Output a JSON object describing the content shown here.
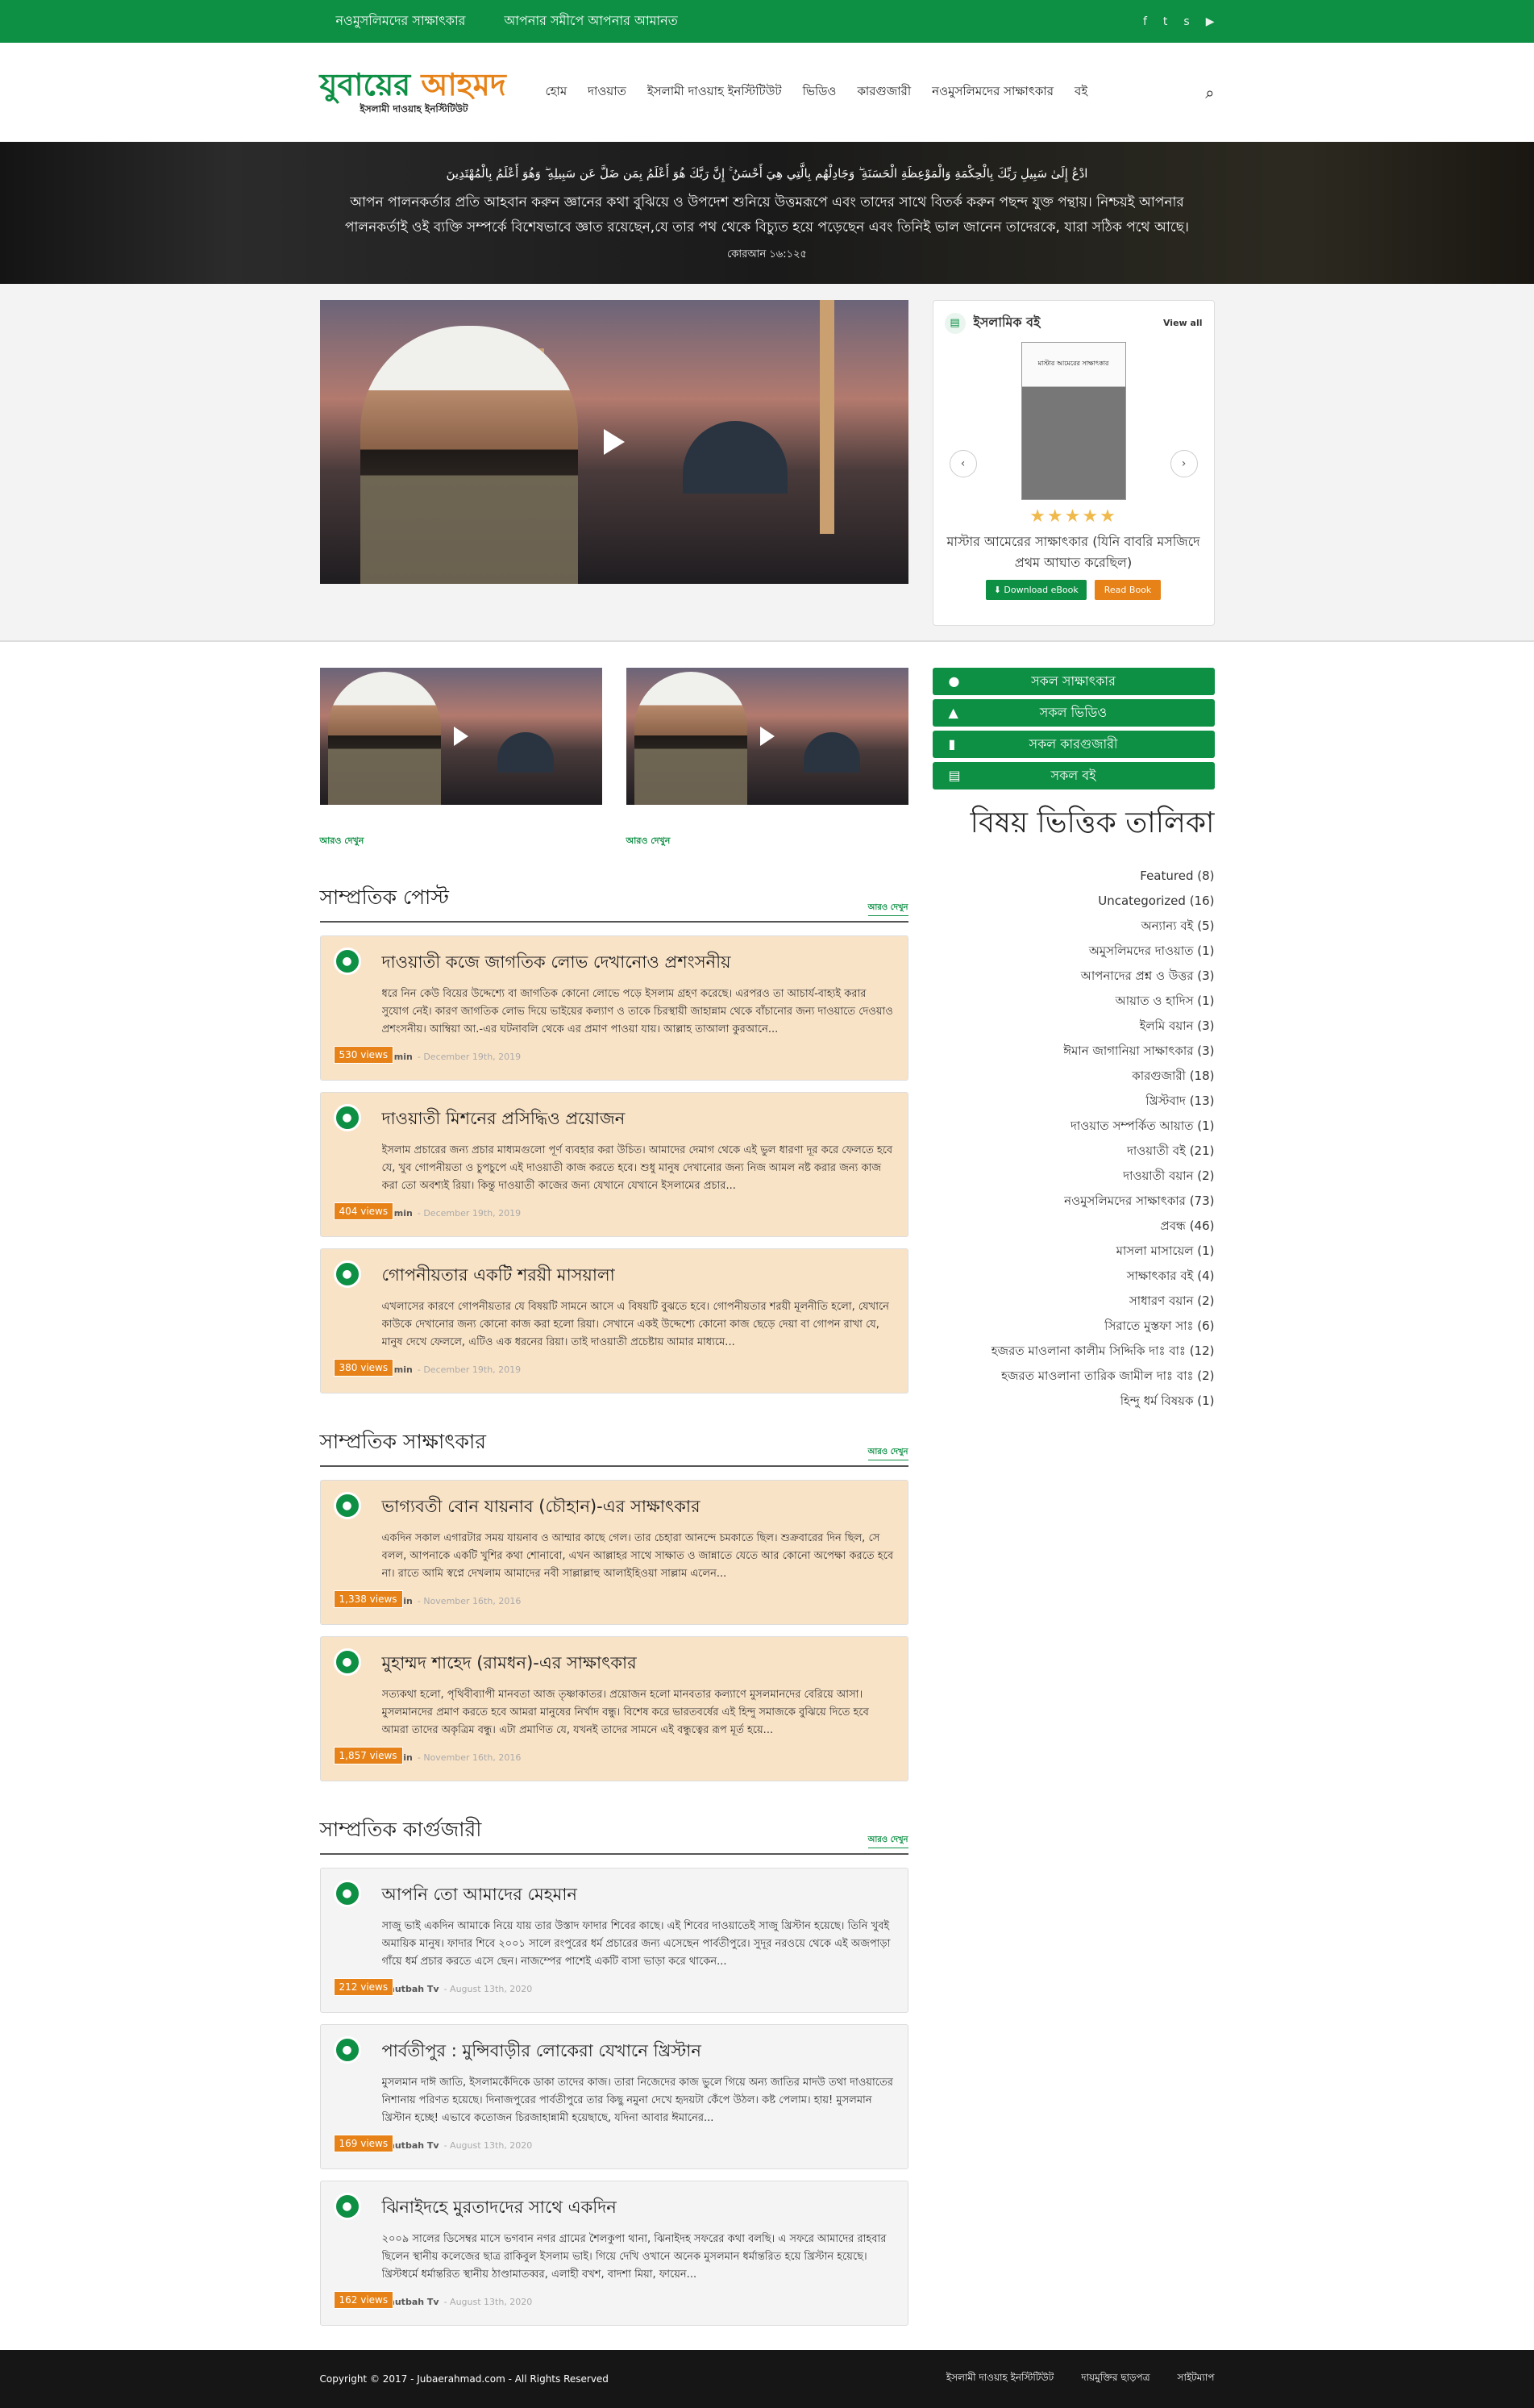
{
  "topbar": {
    "links": [
      "নওমুসলিমদের সাক্ষাৎকার",
      "আপনার সমীপে আপনার আমানত"
    ],
    "social": [
      "f",
      "t",
      "s",
      "▶"
    ]
  },
  "header": {
    "logo_name": "যুবায়ের",
    "logo_name2": "আহমদ",
    "logo_sub": "ইসলামী দাওয়াহ ইনস্টিটিউট",
    "nav": [
      "হোম",
      "দাওয়াত",
      "ইসলামী দাওয়াহ ইনস্টিটিউট",
      "ভিডিও",
      "কারগুজারী",
      "নওমুসলিমদের সাক্ষাৎকার",
      "বই"
    ]
  },
  "banner": {
    "arabic": "ادْعُ إِلَىٰ سَبِيلِ رَبِّكَ بِالْحِكْمَةِ وَالْمَوْعِظَةِ الْحَسَنَةِ ۖ وَجَادِلْهُم بِالَّتِي هِيَ أَحْسَنُ ۚ إِنَّ رَبَّكَ هُوَ أَعْلَمُ بِمَن ضَلَّ عَن سَبِيلِهِ ۖ وَهُوَ أَعْلَمُ بِالْمُهْتَدِينَ",
    "bangla": "আপন পালনকর্তার প্রতি আহবান করুন জ্ঞানের কথা বুঝিয়ে ও উপদেশ শুনিয়ে উত্তমরূপে এবং তাদের সাথে বিতর্ক করুন পছন্দ যুক্ত পন্থায়। নিশ্চয়ই আপনার পালনকর্তাই ওই ব্যক্তি সম্পর্কে বিশেষভাবে জ্ঞাত রয়েছেন,যে তার পথ থেকে বিচ্যুত হয়ে পড়েছেন এবং তিনিই ভাল জানেন তাদেরকে, যারা সঠিক পথে আছে।",
    "ref": "কোরআন ১৬:১২৫"
  },
  "bookbox": {
    "title": "ইসলামিক বই",
    "view_all": "View all",
    "cover_text": "মাস্টার আমেরের সাক্ষাৎকার",
    "stars": "★★★★★",
    "book_title": "মাস্টার আমেরের সাক্ষাৎকার (যিনি বাবরি মসজিদে প্রথম আঘাত করেছিল)",
    "download": "⬇ Download eBook",
    "read": "Read Book"
  },
  "small_videos": {
    "more": "আরও দেখুন"
  },
  "sections": [
    {
      "title": "সাম্প্রতিক পোস্ট",
      "more": "আরও দেখুন",
      "style": "peach",
      "items": [
        {
          "title": "দাওয়াতী কজে জাগতিক লোভ দেখানোও প্রশংসনীয়",
          "excerpt": "ধরে নিন কেউ বিয়ের উদ্দেশ্যে বা জাগতিক কোনো লোভে পড়ে ইসলাম গ্রহণ করেছে। এরপরও তা আচার্য-বাহ্যই করার সুযোগ নেই। কারণ জাগতিক লোভ দিয়ে ভাইয়ের কল্যাণ ও তাকে চিরস্থায়ী জাহান্নাম থেকে বাঁচানোর জন্য দাওয়াতে দেওয়াও প্রশংসনীয়। আম্বিয়া আ.-এর ঘটনাবলি থেকে এর প্রমাণ পাওয়া যায়। আল্লাহ তাআলা কুরআনে...",
          "views": "530 views",
          "author": "admin",
          "date": "- December 19th, 2019"
        },
        {
          "title": "দাওয়াতী মিশনের প্রসিদ্ধিও প্রয়োজন",
          "excerpt": "ইসলাম প্রচারের জন্য প্রচার মাধ্যমগুলো পূর্ণ ব্যবহার করা উচিত। আমাদের দেমাগ থেকে এই ভুল ধারণা দূর করে ফেলতে হবে যে, খুব গোপনীয়তা ও চুপচুপে এই দাওয়াতী কাজ করতে হবে। শুধু মানুষ দেখানোর জন্য নিজ আমল নষ্ট করার জন্য কাজ করা তো অবশ্যই রিয়া। কিন্তু দাওয়াতী কাজের জন্য যেখানে যেখানে ইসলামের প্রচার...",
          "views": "404 views",
          "author": "admin",
          "date": "- December 19th, 2019"
        },
        {
          "title": "গোপনীয়তার একটি শরয়ী মাসয়ালা",
          "excerpt": "এখলাসের কারণে গোপনীয়তার যে বিষয়টি সামনে আসে এ বিষয়টি বুঝতে হবে। গোপনীয়তার শরয়ী মূলনীতি হলো, যেখানে কাউকে দেখানোর জন্য কোনো কাজ করা হলো রিয়া। সেখানে একই উদ্দেশ্যে কোনো কাজ ছেড়ে দেয়া বা গোপন রাখা যে, মানুষ দেখে ফেললে, এটিও এক ধরনের রিয়া। তাই দাওয়াতী প্রচেষ্টায় আমার মাধ্যমে...",
          "views": "380 views",
          "author": "admin",
          "date": "- December 19th, 2019"
        }
      ]
    },
    {
      "title": "সাম্প্রতিক সাক্ষাৎকার",
      "more": "আরও দেখুন",
      "style": "peach",
      "items": [
        {
          "title": "ভাগ্যবতী বোন যায়নাব (চৌহান)-এর সাক্ষাৎকার",
          "excerpt": "একদিন সকাল এগারটার সময় যায়নাব ও আম্মার কাছে গেল। তার চেহারা আনন্দে চমকাতে ছিল। শুক্রবারের দিন ছিল, সে বলল, আপনাকে একটি খুশির কথা শোনাবো, এখন আল্লাহর সাথে সাক্ষাত ও জান্নাতে যেতে আর কোনো অপেক্ষা করতে হবে না। রাতে আমি স্বপ্নে দেখলাম আমাদের নবী সাল্লাল্লাহু আলাইহিওয়া সাল্লাম এলেন...",
          "views": "1,338 views",
          "author": "admin",
          "date": "- November 16th, 2016"
        },
        {
          "title": "মুহাম্মদ শাহেদ (রামধন)-এর সাক্ষাৎকার",
          "excerpt": "সত্যকথা হলো, পৃথিবীব্যাপী মানবতা আজ তৃষ্ণাকাতর। প্রয়োজন হলো মানবতার কল্যাণে মুসলমানদের বেরিয়ে আসা। মুসলমানদের প্রমাণ করতে হবে আমরা মানুষের নির্খাদ বন্ধু। বিশেষ করে ভারতবর্ষের এই হিন্দু সমাজকে বুঝিয়ে দিতে হবে আমরা তাদের অকৃত্রিম বন্ধু। এটা প্রমাণিত যে, যখনই তাদের সামনে এই বন্ধুত্বের রূপ মূর্ত হয়ে...",
          "views": "1,857 views",
          "author": "admin",
          "date": "- November 16th, 2016"
        }
      ]
    },
    {
      "title": "সাম্প্রতিক কার্গুজারী",
      "more": "আরও দেখুন",
      "style": "grey",
      "items": [
        {
          "title": "আপনি তো আমাদের মেহমান",
          "excerpt": "সাজু ভাই একদিন আমাকে নিয়ে যায় তার উস্তাদ ফাদার শিবের কাছে। এই শিবের দাওয়াতেই সাজু খ্রিস্টান হয়েছে। তিনি খুবই অমায়িক মানুষ। ফাদার শিবে ২০০১ সালে রংপুরের ধর্ম প্রচারের জন্য এসেছেন পার্বতীপুরে। সুদূর নরওয়ে থেকে এই অজপাড়া গাঁয়ে ধর্ম প্রচার করতে এসে ছেন। নাজম্পের পাশেই একটি বাসা ভাড়া করে থাকেন...",
          "views": "212 views",
          "author": "Khutbah Tv",
          "date": "- August 13th, 2020"
        },
        {
          "title": "পার্বতীপুর : মুন্সিবাড়ীর লোকেরা যেখানে খ্রিস্টান",
          "excerpt": "মুসলমান দাঈ জাতি, ইসলামকেঁদিকে ডাকা তাদের কাজ। তারা নিজেদের কাজ ভুলে গিয়ে অন্য জাতির মাদউ তথা দাওয়াতের নিশানায় পরিণত হয়েছে। দিনাজপুরের পার্বতীপুরে তার কিছু নমুনা দেখে হৃদয়টা কেঁপে উঠল। কষ্ট পেলাম। হায়! মুসলমান খ্রিস্টান হচ্ছে! এভাবে কতোজন চিরজাহান্নামী হয়েছাছে, যদিনা আবার ঈমানের...",
          "views": "169 views",
          "author": "Khutbah Tv",
          "date": "- August 13th, 2020"
        },
        {
          "title": "ঝিনাইদহে মুরতাদদের সাথে একদিন",
          "excerpt": "২০০৯ সালের ডিসেম্বর মাসে ভগবান নগর গ্রামের শৈলকুপা থানা, ঝিনাইদহ সফরের কথা বলছি। এ সফরে আমাদের রাহবার ছিলেন স্থানীয় কলেজের ছাত্র রাকিবুল ইসলাম ভাই। গিয়ে দেখি ওখানে অনেক মুসলমান ধর্মান্তরিত হয়ে খ্রিস্টান হয়েছে। খ্রিস্টধর্মে ধর্মান্তরিত স্থানীয় ঠাণ্ডামাতব্বর, এলাহী বখশ, বাদশা মিয়া, ফায়েন...",
          "views": "162 views",
          "author": "Khutbah Tv",
          "date": "- August 13th, 2020"
        }
      ]
    }
  ],
  "sidebar": {
    "buttons": [
      "সকল সাক্ষাৎকার",
      "সকল ভিডিও",
      "সকল কারগুজারী",
      "সকল বই"
    ],
    "tax_title": "বিষয় ভিত্তিক তালিকা",
    "tax": [
      "Featured (8)",
      "Uncategorized (16)",
      "অন্যান্য বই (5)",
      "অমুসলিমদের দাওয়াত (1)",
      "আপনাদের প্রশ্ন ও উত্তর (3)",
      "আয়াত ও হাদিস (1)",
      "ইলমি বয়ান (3)",
      "ঈমান জাগানিয়া সাক্ষাৎকার (3)",
      "কারগুজারী (18)",
      "খ্রিস্টবাদ (13)",
      "দাওয়াত সম্পর্কিত আয়াত (1)",
      "দাওয়াতী বই (21)",
      "দাওয়াতী বয়ান (2)",
      "নওমুসলিমদের সাক্ষাৎকার (73)",
      "প্রবন্ধ (46)",
      "মাসলা মাসায়েল (1)",
      "সাক্ষাৎকার বই (4)",
      "সাধারণ বয়ান (2)",
      "সিরাতে মুস্তফা সাঃ (6)",
      "হজরত মাওলানা কালীম সিদ্দিকি দাঃ বাঃ (12)",
      "হজরত মাওলানা তারিক জামীল দাঃ বাঃ (2)",
      "হিন্দু ধর্ম বিষয়ক (1)"
    ]
  },
  "footer": {
    "copyright": "Copyright © 2017 - Jubaerahmad.com - All Rights Reserved",
    "links": [
      "ইসলামী দাওয়াহ ইনস্টিটিউট",
      "দায়মুক্তির ছাড়পত্র",
      "সাইটম্যাপ"
    ]
  }
}
